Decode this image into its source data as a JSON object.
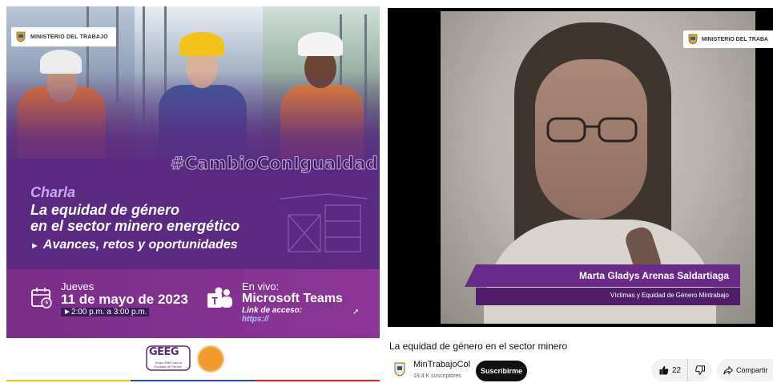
{
  "poster": {
    "ministry_label": "MINISTERIO DEL TRABAJO",
    "hashtag": "#CambioConIgualdad",
    "charla": "Charla",
    "title_line1": "La equidad de género",
    "title_line2": "en el sector minero energético",
    "subtitle": "Avances, retos y oportunidades",
    "day": "Jueves",
    "date": "11 de mayo de 2023",
    "time": "►2:00 p.m. a 3:00 p.m.",
    "envivo": "En vivo:",
    "platform": "Microsoft Teams",
    "link_label": "Link de acceso:",
    "link_url": "https://",
    "logo_text": "GEEG",
    "logo_subtext": "Grupo Élite para la Equidad de Género",
    "colors": {
      "purple_dark": "#5a2a82",
      "band": "#8b3596",
      "accent_light": "#c9a8f0",
      "orange": "#f29a2e"
    }
  },
  "player": {
    "overlay_badge": "MINISTERIO DEL TRABA",
    "speaker_name": "Marta Gladys Arenas Saldartiaga",
    "speaker_role": "Víctimas y Equidad de Género Mintrabajo",
    "lower_third_color": "#6a2a8a"
  },
  "video": {
    "title": "La equidad de género en el sector minero",
    "channel_name": "MinTrabajoCol",
    "subscribers": "19,4 K suscriptores",
    "subscribe_label": "Suscribirme",
    "likes": "22",
    "share_label": "Compartir"
  },
  "icons": [
    "crest-icon",
    "calendar-icon",
    "teams-icon",
    "thumbs-up-icon",
    "thumbs-down-icon",
    "share-icon"
  ]
}
